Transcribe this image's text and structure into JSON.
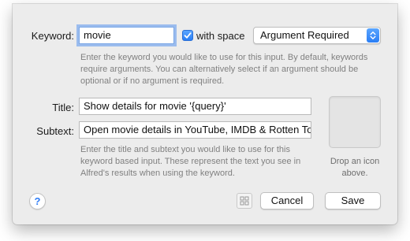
{
  "keyword": {
    "label": "Keyword:",
    "value": "movie",
    "with_space_label": "with space",
    "with_space_checked": true,
    "argument_select": {
      "selected": "Argument Required"
    },
    "hint": "Enter the keyword you would like to use for this input. By default, keywords require arguments. You can alternatively select if an argument should be optional or if no argument is required."
  },
  "title": {
    "label": "Title:",
    "value": "Show details for movie '{query}'"
  },
  "subtext": {
    "label": "Subtext:",
    "value": "Open movie details in YouTube, IMDB & Rotten Tomatoes",
    "hint": "Enter the title and subtext you would like to use for this keyword based input. These represent the text you see in Alfred's results when using the keyword."
  },
  "icon_well": {
    "caption": "Drop an icon above."
  },
  "footer": {
    "help_label": "?",
    "cancel_label": "Cancel",
    "save_label": "Save"
  },
  "colors": {
    "accent": "#2f7df6",
    "sheet_bg": "#ececec",
    "hint_text": "#808080"
  },
  "icons": [
    "checkmark-icon",
    "popup-arrows-icon",
    "help-icon",
    "grid-icon"
  ]
}
